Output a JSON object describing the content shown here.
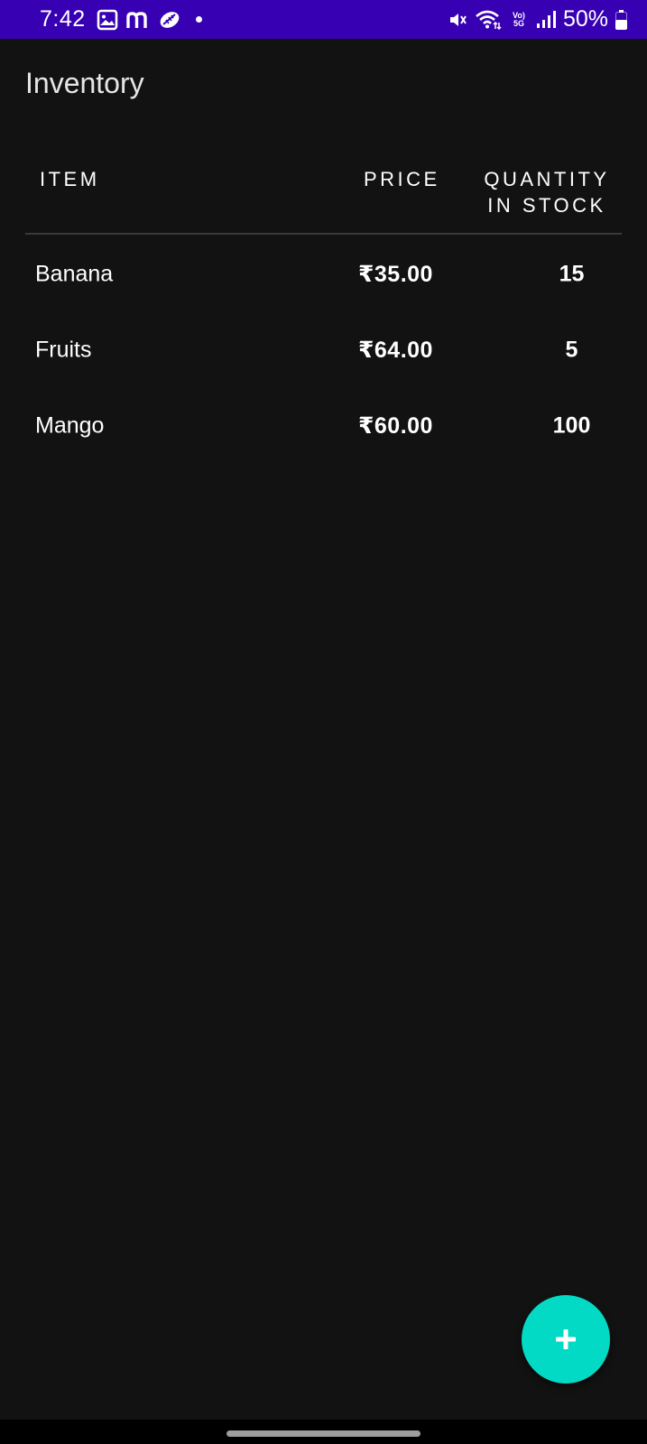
{
  "status_bar": {
    "time": "7:42",
    "battery_percent": "50%",
    "network_label": "Vo) 5G",
    "left_icons": [
      "gallery-icon",
      "m-app-icon",
      "leaf-app-icon",
      "notification-dot-icon"
    ],
    "right_icons": [
      "vibrate-mute-icon",
      "wifi-icon",
      "volte-5g-icon",
      "signal-icon",
      "battery-icon"
    ],
    "color": "#3700b3"
  },
  "app_bar": {
    "title": "Inventory"
  },
  "table": {
    "headers": {
      "item": "ITEM",
      "price": "PRICE",
      "quantity_line1": "QUANTITY",
      "quantity_line2": "IN STOCK"
    },
    "rows": [
      {
        "name": "Banana",
        "price": "₹35.00",
        "quantity": "15"
      },
      {
        "name": "Fruits",
        "price": "₹64.00",
        "quantity": "5"
      },
      {
        "name": "Mango",
        "price": "₹60.00",
        "quantity": "100"
      }
    ]
  },
  "fab": {
    "icon": "plus-icon",
    "color": "#03dac5"
  },
  "colors": {
    "background": "#121212",
    "divider": "#3a3a3a"
  }
}
